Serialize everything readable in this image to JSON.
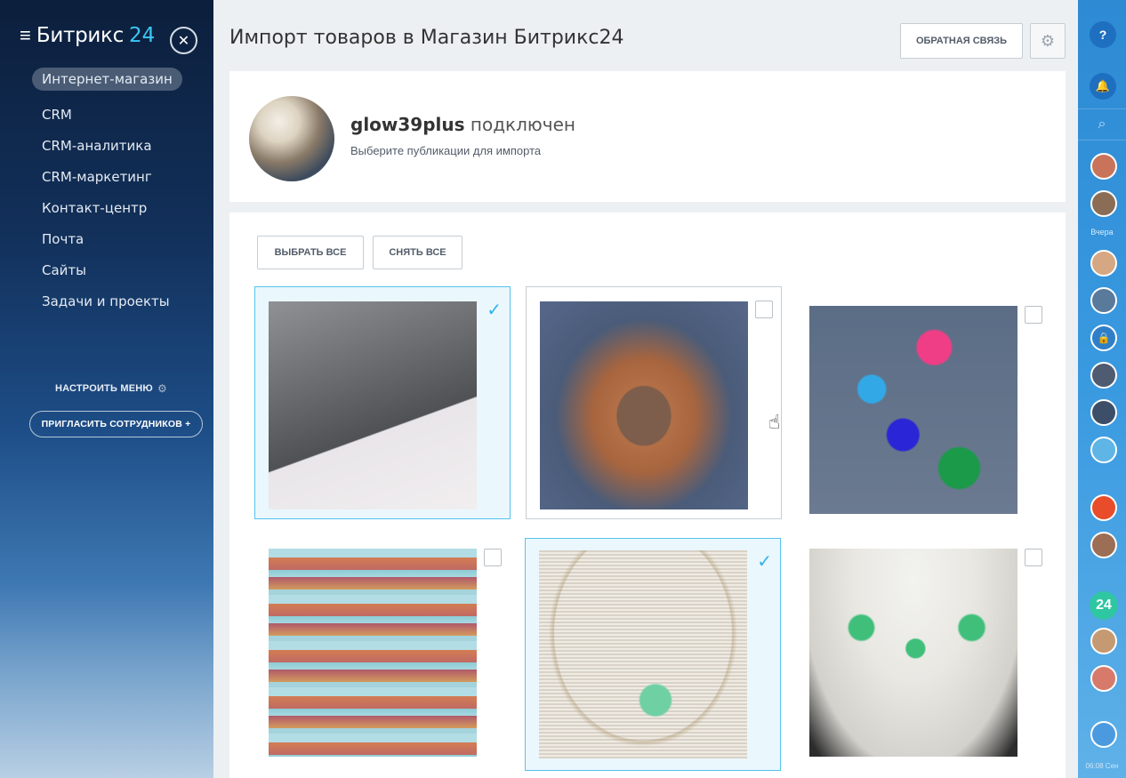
{
  "sidebar": {
    "logo_text": "Битрикс",
    "logo_num": "24",
    "items": [
      {
        "label": "Интернет-магазин"
      },
      {
        "label": "CRM"
      },
      {
        "label": "CRM-аналитика"
      },
      {
        "label": "CRM-маркетинг"
      },
      {
        "label": "Контакт-центр"
      },
      {
        "label": "Почта"
      },
      {
        "label": "Сайты"
      },
      {
        "label": "Задачи и проекты"
      }
    ],
    "setup_menu": "НАСТРОИТЬ МЕНЮ",
    "invite": "ПРИГЛАСИТЬ СОТРУДНИКОВ +"
  },
  "header": {
    "title": "Импорт товаров в Магазин Битрикс24",
    "feedback": "ОБРАТНАЯ СВЯЗЬ"
  },
  "profile": {
    "username": "glow39plus",
    "status": "подключен",
    "subtitle": "Выберите публикации для импорта"
  },
  "actions": {
    "select_all": "ВЫБРАТЬ ВСЕ",
    "deselect_all": "СНЯТЬ ВСЕ"
  },
  "tiles": [
    {
      "name": "photo-earrings-bracelet",
      "selected": true
    },
    {
      "name": "photo-copper-bracelet",
      "selected": false
    },
    {
      "name": "photo-stone-pendants",
      "selected": false
    },
    {
      "name": "photo-earrings-display",
      "selected": false
    },
    {
      "name": "photo-green-necklace",
      "selected": true
    },
    {
      "name": "photo-green-jewelry-set",
      "selected": false
    }
  ],
  "right_panel": {
    "day_label": "Вчера",
    "counter": "24",
    "time": "06:08 Сен"
  },
  "colors": {
    "accent": "#2fb4ec",
    "selected_border": "#55c4ec",
    "selected_bg": "#eaf7fd",
    "brand_24": "#3bc8f5"
  }
}
